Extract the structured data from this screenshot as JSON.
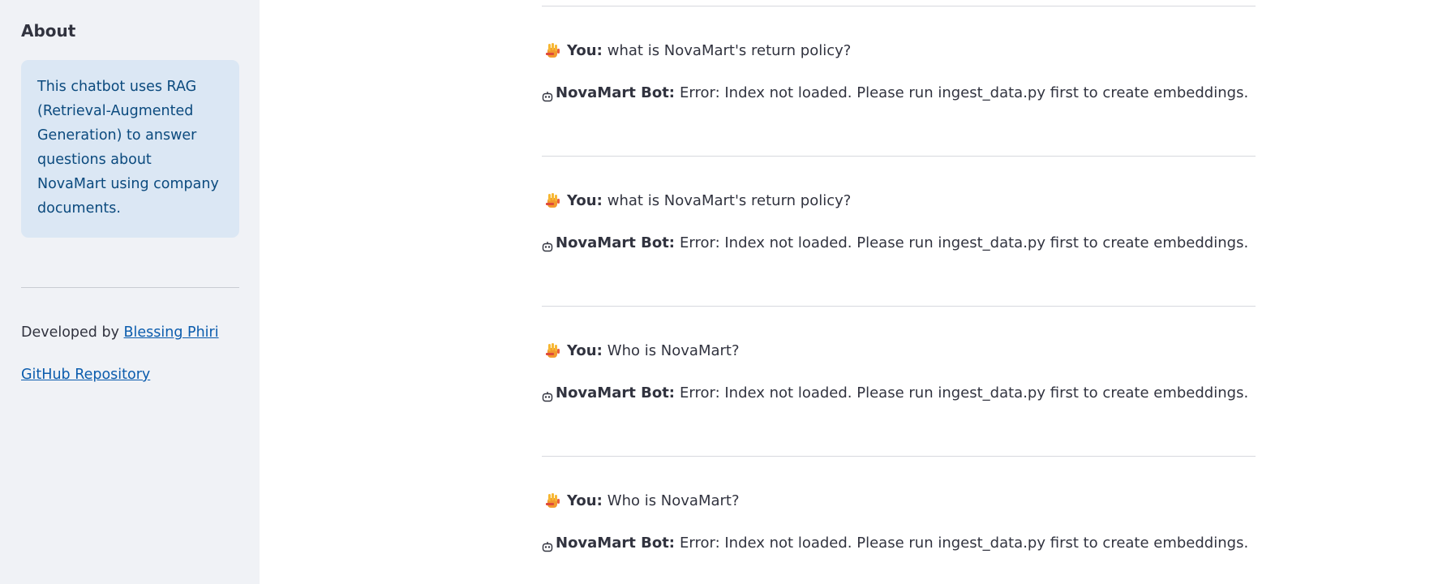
{
  "sidebar": {
    "heading": "About",
    "info": "This chatbot uses RAG (Retrieval-Augmented Generation) to answer questions about NovaMart using company documents.",
    "developed_by_prefix": "Developed by",
    "developer_name": "Blessing Phiri",
    "github_label": "GitHub Repository"
  },
  "chat": {
    "user_label": "You:",
    "bot_label": "NovaMart Bot:",
    "user_icon": "raised-hand-emoji-icon",
    "bot_icon": "robot-face-icon",
    "messages": [
      {
        "user": "what is NovaMart's return policy?",
        "bot": "Error: Index not loaded. Please run ingest_data.py first to create embeddings."
      },
      {
        "user": "what is NovaMart's return policy?",
        "bot": "Error: Index not loaded. Please run ingest_data.py first to create embeddings."
      },
      {
        "user": "Who is NovaMart?",
        "bot": "Error: Index not loaded. Please run ingest_data.py first to create embeddings."
      },
      {
        "user": "Who is NovaMart?",
        "bot": "Error: Index not loaded. Please run ingest_data.py first to create embeddings."
      }
    ]
  },
  "colors": {
    "sidebar_bg": "#f0f2f6",
    "info_bg": "#dbe7f4",
    "info_text": "#0b4a7e",
    "link": "#0b5cad",
    "text": "#31333f"
  }
}
